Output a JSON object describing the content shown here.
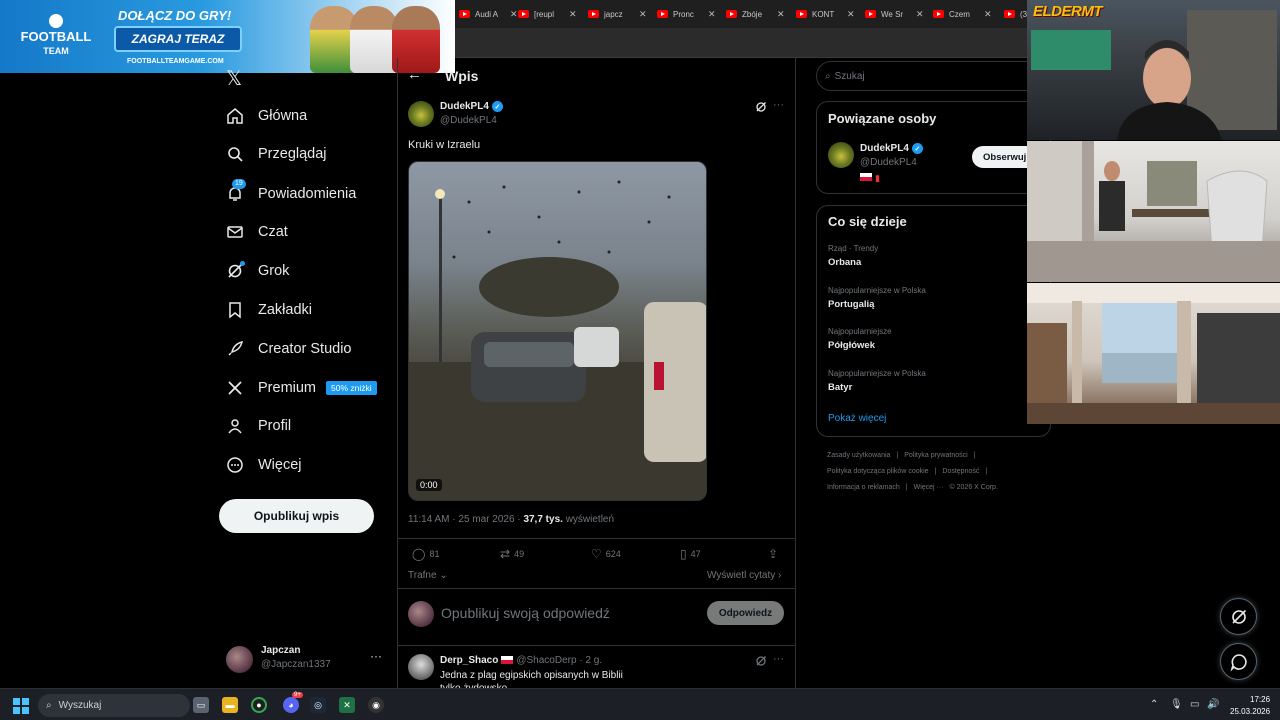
{
  "ad": {
    "logo_line1": "FOOTBALL",
    "logo_line2": "TEAM",
    "headline": "DOŁĄCZ DO GRY!",
    "cta": "ZAGRAJ TERAZ",
    "url": "FOOTBALLTEAMGAME.COM"
  },
  "browser": {
    "tabs": [
      {
        "label": "Audi A",
        "icon": "youtube-icon"
      },
      {
        "label": "[reupl",
        "icon": "youtube-icon"
      },
      {
        "label": "japcz",
        "icon": "youtube-icon"
      },
      {
        "label": "Pronc",
        "icon": "youtube-icon"
      },
      {
        "label": "Zbóje",
        "icon": "youtube-icon"
      },
      {
        "label": "KONT",
        "icon": "youtube-icon"
      },
      {
        "label": "We Sr",
        "icon": "youtube-icon"
      },
      {
        "label": "Czem",
        "icon": "youtube-icon"
      },
      {
        "label": "(3",
        "icon": "youtube-icon"
      }
    ]
  },
  "sidebar": {
    "items": [
      {
        "label": "Główna",
        "icon": "home-icon"
      },
      {
        "label": "Przeglądaj",
        "icon": "search-icon"
      },
      {
        "label": "Powiadomienia",
        "icon": "bell-icon",
        "badge": "19"
      },
      {
        "label": "Czat",
        "icon": "mail-icon"
      },
      {
        "label": "Grok",
        "icon": "grok-icon"
      },
      {
        "label": "Zakładki",
        "icon": "bookmark-icon"
      },
      {
        "label": "Creator Studio",
        "icon": "rocket-icon"
      },
      {
        "label": "Premium",
        "icon": "x-icon",
        "promo": "50% zniżki"
      },
      {
        "label": "Profil",
        "icon": "person-icon"
      },
      {
        "label": "Więcej",
        "icon": "more-circle-icon"
      }
    ],
    "publish_label": "Opublikuj wpis",
    "account": {
      "name": "Japczan",
      "handle": "@Japczan1337"
    }
  },
  "main": {
    "title": "Wpis",
    "post": {
      "author": "DudekPL4",
      "handle": "@DudekPL4",
      "text": "Kruki w Izraelu",
      "video_time": "0:00",
      "timestamp": "11:14 AM · 25 mar 2026 · ",
      "views": "37,7 tys.",
      "views_label": " wyświetleń",
      "stats": {
        "replies": "81",
        "reposts": "49",
        "likes": "624",
        "bookmarks": "47"
      }
    },
    "sort_label": "Trafne",
    "show_quotes": "Wyświetl cytaty",
    "reply_placeholder": "Opublikuj swoją odpowiedź",
    "reply_button": "Odpowiedz",
    "comment": {
      "author": "Derp_Shaco",
      "handle": "@ShacoDerp · 2 g.",
      "text": "Jedna z plag egipskich opisanych w Biblii tylko żydowsko"
    }
  },
  "right": {
    "search_placeholder": "Szukaj",
    "related": {
      "title": "Powiązane osoby",
      "name": "DudekPL4",
      "handle": "@DudekPL4",
      "follow": "Obserwuj"
    },
    "trends": {
      "title": "Co się dzieje",
      "items": [
        {
          "context": "Rząd · Trendy",
          "topic": "Orbana"
        },
        {
          "context": "Najpopularniejsze w Polska",
          "topic": "Portugalią"
        },
        {
          "context": "Najpopularniejsze",
          "topic": "Półgłówek"
        },
        {
          "context": "Najpopularniejsze w Polska",
          "topic": "Batyr"
        }
      ],
      "show_more": "Pokaż więcej"
    },
    "footer": {
      "line1": [
        "Zasady użytkowania",
        "|",
        "Polityka prywatności",
        "|"
      ],
      "line2": [
        "Polityka dotycząca plików cookie",
        "|",
        "Dostępność",
        "|"
      ],
      "line3": [
        "Informacja o reklamach",
        "|",
        "Więcej ···",
        "© 2026 X Corp."
      ]
    }
  },
  "overlay": {
    "brand": "ELDERMT"
  },
  "taskbar": {
    "search_placeholder": "Wyszukaj",
    "discord_badge": "9+",
    "time": "17:26",
    "date": "25.03.2026"
  }
}
